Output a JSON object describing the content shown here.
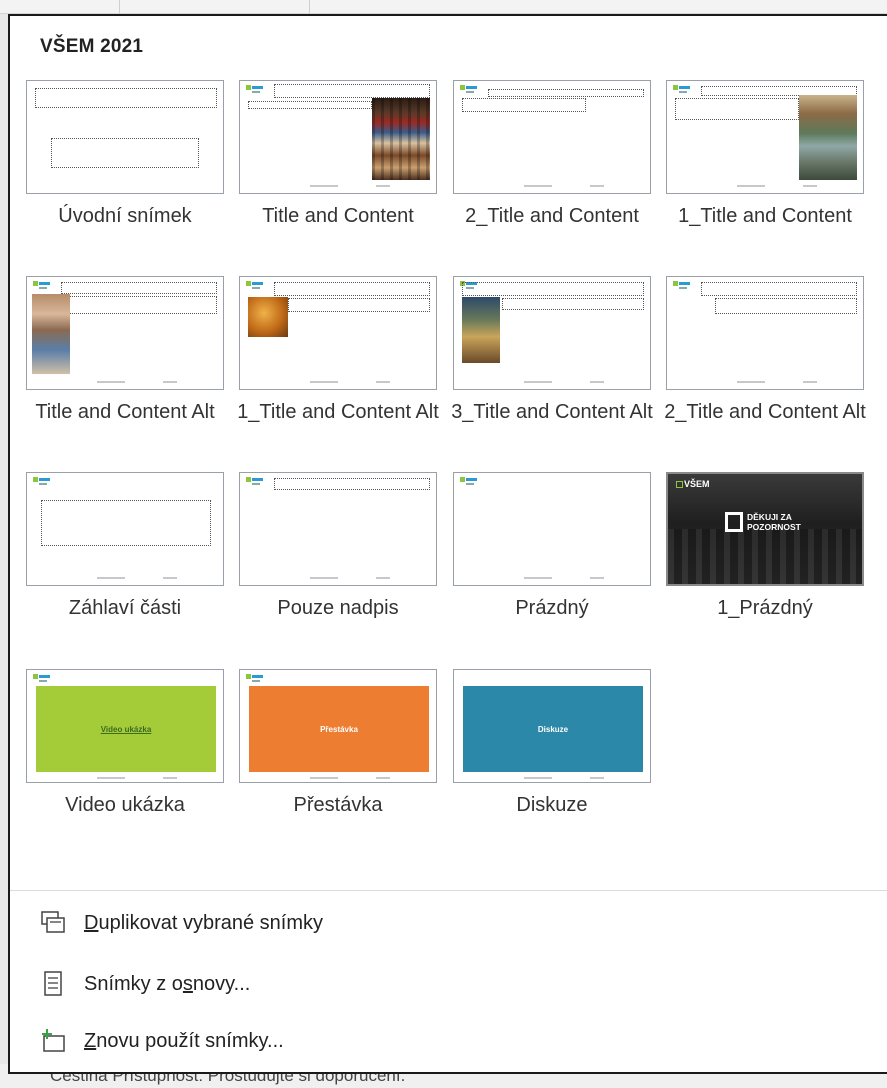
{
  "panel_title": "VŠEM 2021",
  "layouts": [
    {
      "label": "Úvodní snímek"
    },
    {
      "label": "Title and Content"
    },
    {
      "label": "2_Title and Content"
    },
    {
      "label": "1_Title and Content"
    },
    {
      "label": "Title and Content Alt"
    },
    {
      "label": "1_Title and Content Alt"
    },
    {
      "label": "3_Title and Content Alt"
    },
    {
      "label": "2_Title and Content Alt"
    },
    {
      "label": "Záhlaví části"
    },
    {
      "label": "Pouze nadpis"
    },
    {
      "label": "Prázdný"
    },
    {
      "label": "1_Prázdný"
    },
    {
      "label": "Video ukázka"
    },
    {
      "label": "Přestávka"
    },
    {
      "label": "Diskuze"
    }
  ],
  "thumb_text": {
    "dark_logo": "VŠEM",
    "thanks_line1": "DĚKUJI ZA",
    "thanks_line2": "POZORNOST",
    "video": "Video ukázka",
    "break": "Přestávka",
    "discussion": "Diskuze"
  },
  "colors": {
    "video_green": "#a4cc39",
    "break_orange": "#ed7d31",
    "discussion_blue": "#2b88a8"
  },
  "menu": {
    "duplicate": {
      "mnemonic": "D",
      "rest": "uplikovat vybrané snímky",
      "icon": "duplicate-slides-icon"
    },
    "outline": {
      "before": "Snímky z o",
      "mnemonic": "s",
      "after": "novy...",
      "icon": "outline-document-icon"
    },
    "reuse": {
      "mnemonic": "Z",
      "rest": "novu použít snímky...",
      "icon": "reuse-slides-icon"
    }
  },
  "statusbar_text": "Čeština    Přístupnost: Prostudujte si doporučení."
}
